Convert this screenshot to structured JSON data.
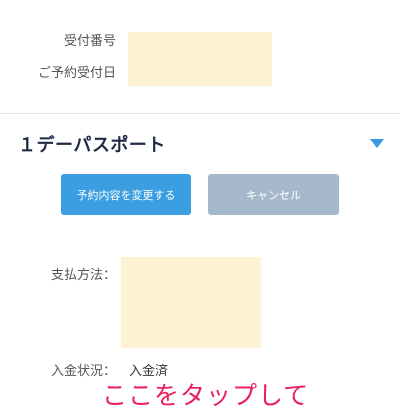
{
  "reservation": {
    "receipt_number_label": "受付番号",
    "reservation_date_label": "ご予約受付日"
  },
  "ticket": {
    "title": "１デーパスポート",
    "change_button_label": "予約内容を変更する",
    "cancel_button_label": "キャンセル"
  },
  "payment": {
    "method_label": "支払方法：",
    "status_label": "入金状況：",
    "status_value": "入金済"
  },
  "annotation": {
    "text": "ここをタップして"
  },
  "colors": {
    "accent": "#3a9ee0",
    "cancel": "#a6b9cc",
    "annotation": "#e8205c",
    "masked": "#fdf3d2"
  }
}
